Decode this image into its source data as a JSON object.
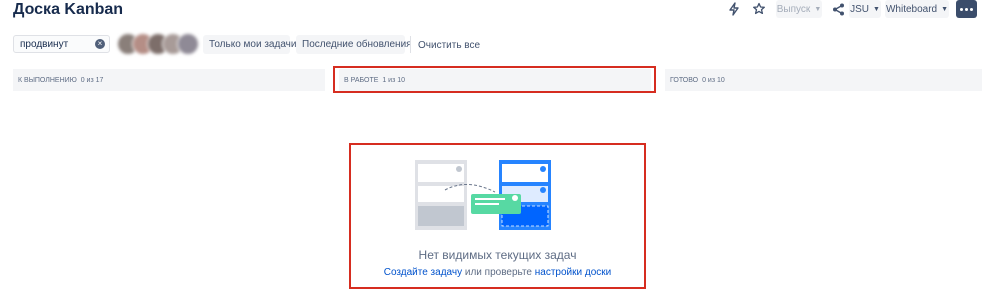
{
  "page_title": "Доска Kanban",
  "toolbar": {
    "release_label": "Выпуск",
    "project_label": "JSU",
    "whiteboard_label": "Whiteboard"
  },
  "filters": {
    "search_value": "продвинут",
    "only_my_issues": "Только мои задачи",
    "recently_updated": "Последние обновления",
    "clear_all": "Очистить все"
  },
  "columns": [
    {
      "name": "К выполнению",
      "count": "0 из 17"
    },
    {
      "name": "В работе",
      "count": "1 из 10"
    },
    {
      "name": "Готово",
      "count": "0 из 10"
    }
  ],
  "empty_state": {
    "title": "Нет видимых текущих задач",
    "create_link": "Создайте задачу",
    "middle_text": " или проверьте ",
    "settings_link": "настройки доски"
  },
  "colors": {
    "highlight": "#d62d20",
    "link": "#0052cc",
    "column_bg": "#f4f5f7"
  }
}
